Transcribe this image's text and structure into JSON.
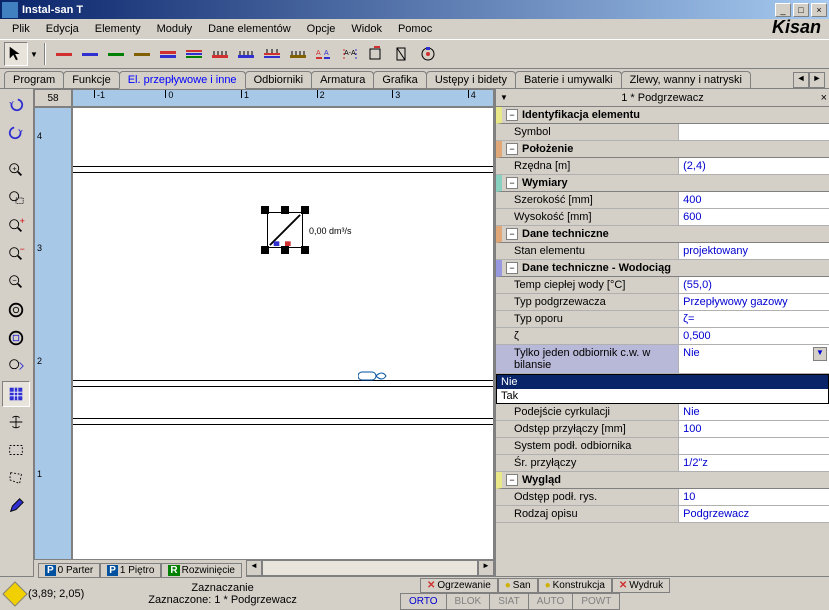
{
  "window": {
    "title": "Instal-san T"
  },
  "menu": [
    "Plik",
    "Edycja",
    "Elementy",
    "Moduły",
    "Dane elementów",
    "Opcje",
    "Widok",
    "Pomoc"
  ],
  "brand": "Kisan",
  "tabs": {
    "items": [
      "Program",
      "Funkcje",
      "El. przepływowe i inne",
      "Odbiorniki",
      "Armatura",
      "Grafika",
      "Ustępy i bidety",
      "Baterie i umywalki",
      "Zlewy, wanny i natryski"
    ],
    "active_index": 2
  },
  "ruler": {
    "corner": "58",
    "h_ticks": [
      "-1",
      "0",
      "1",
      "2",
      "3",
      "4"
    ],
    "v_ticks": [
      "4",
      "3",
      "2",
      "1"
    ]
  },
  "canvas": {
    "obj_label": "0,00 dm³/s"
  },
  "floor_tabs": [
    {
      "badge": "P",
      "label": "0 Parter"
    },
    {
      "badge": "P",
      "label": "1 Piętro"
    },
    {
      "badge": "R",
      "label": "Rozwinięcie",
      "green": true
    }
  ],
  "prop_header": "1 * Podgrzewacz",
  "sections": {
    "ident": {
      "title": "Identyfikacja elementu",
      "rows": [
        [
          "Symbol",
          ""
        ]
      ]
    },
    "pos": {
      "title": "Położenie",
      "rows": [
        [
          "Rzędna [m]",
          "(2,4)"
        ]
      ]
    },
    "dim": {
      "title": "Wymiary",
      "rows": [
        [
          "Szerokość [mm]",
          "400"
        ],
        [
          "Wysokość [mm]",
          "600"
        ]
      ]
    },
    "tech": {
      "title": "Dane techniczne",
      "rows": [
        [
          "Stan elementu",
          "projektowany"
        ]
      ]
    },
    "techw": {
      "title": "Dane techniczne - Wodociąg",
      "rows": [
        [
          "Temp ciepłej wody [°C]",
          "(55,0)"
        ],
        [
          "Typ podgrzewacza",
          "Przepływowy gazowy"
        ],
        [
          "Typ oporu",
          "ζ="
        ],
        [
          "ζ",
          "0,500"
        ],
        [
          "Tylko jeden odbiornik c.w. w bilansie",
          "Nie"
        ],
        [
          "__dropdown__",
          ""
        ],
        [
          "Podejście cyrkulacji",
          "Nie"
        ],
        [
          "Odstęp przyłączy [mm]",
          "100"
        ],
        [
          "System podł. odbiornika",
          ""
        ],
        [
          "Śr. przyłączy",
          "1/2\"z"
        ]
      ]
    },
    "look": {
      "title": "Wygląd",
      "rows": [
        [
          "Odstęp podł. rys.",
          "10"
        ],
        [
          "Rodzaj opisu",
          "Podgrzewacz"
        ]
      ]
    }
  },
  "dropdown_opts": [
    "Nie",
    "Tak"
  ],
  "status": {
    "coords": "(3,89; 2,05)",
    "line1": "Zaznaczanie",
    "line2": "Zaznaczone: 1 * Podgrzewacz",
    "layers": [
      "Ogrzewanie",
      "San",
      "Konstrukcja",
      "Wydruk"
    ],
    "modes": [
      "ORTO",
      "BLOK",
      "SIAT",
      "AUTO",
      "POWT"
    ]
  }
}
